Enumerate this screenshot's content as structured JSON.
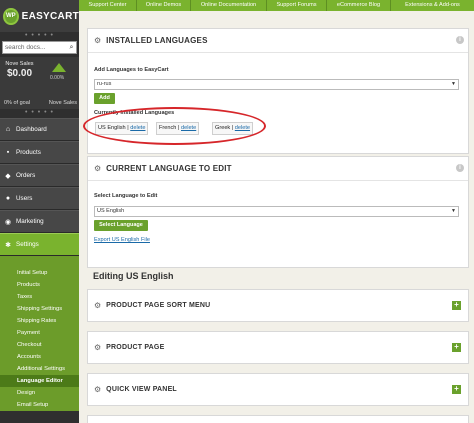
{
  "sidebar": {
    "logo_badge": "WP",
    "logo_text": "EASYCART",
    "search_placeholder": "search docs...",
    "stats": {
      "label": "Nove Sales",
      "value": "$0.00",
      "goal_pct": "0% of goal",
      "right_label": "Nove Sales",
      "chart_pct": "0.00%"
    },
    "nav": [
      {
        "label": "Dashboard",
        "icon": "home-icon",
        "glyph": "⌂"
      },
      {
        "label": "Products",
        "icon": "products-icon",
        "glyph": "▪"
      },
      {
        "label": "Orders",
        "icon": "orders-icon",
        "glyph": "◆"
      },
      {
        "label": "Users",
        "icon": "users-icon",
        "glyph": "●"
      },
      {
        "label": "Marketing",
        "icon": "marketing-icon",
        "glyph": "◉"
      },
      {
        "label": "Settings",
        "icon": "settings-icon",
        "glyph": "✱"
      }
    ],
    "sub_nav": [
      "Initial Setup",
      "Products",
      "Taxes",
      "Shipping Settings",
      "Shipping Rates",
      "Payment",
      "Checkout",
      "Accounts",
      "Additional Settings",
      "Language Editor",
      "Design",
      "Email Setup"
    ],
    "active_sub": "Language Editor"
  },
  "topbar": {
    "tabs": [
      "Support Center",
      "Online Demos",
      "Online Documentation",
      "Support Forums",
      "eCommerce Blog",
      "Extensions & Add-ons"
    ]
  },
  "installed": {
    "title": "INSTALLED LANGUAGES",
    "add_label": "Add Languages to EasyCart",
    "add_value": "ru-rus",
    "add_button": "Add",
    "current_label": "Currently Installed Languages",
    "languages": [
      {
        "name": "US English",
        "delete": "delete"
      },
      {
        "name": "French",
        "delete": "delete"
      },
      {
        "name": "Greek",
        "delete": "delete"
      }
    ]
  },
  "current": {
    "title": "CURRENT LANGUAGE TO EDIT",
    "select_label": "Select Language to Edit",
    "select_value": "US English",
    "select_button": "Select Language",
    "export_link": "Export US English File"
  },
  "editing_heading": "Editing US English",
  "collapsibles": [
    "PRODUCT PAGE SORT MENU",
    "PRODUCT PAGE",
    "QUICK VIEW PANEL"
  ],
  "colors": {
    "accent": "#7ab32e",
    "dark": "#2f2f2f",
    "highlight": "#d6262a"
  }
}
